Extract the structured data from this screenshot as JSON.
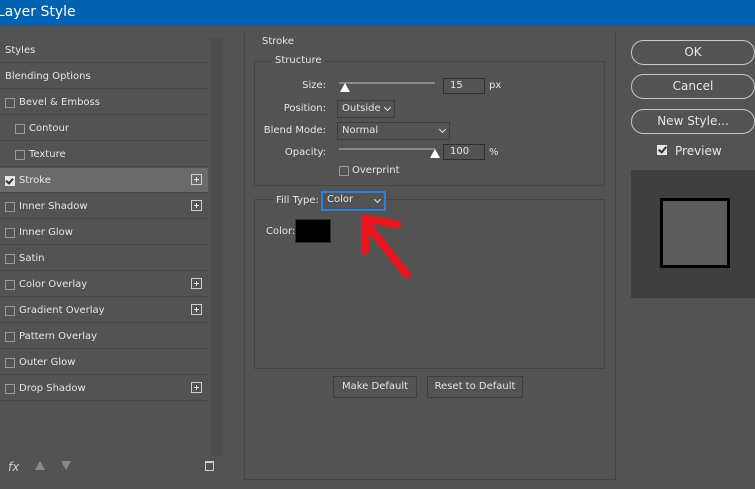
{
  "window": {
    "title": "Layer Style"
  },
  "sidebar": {
    "items": [
      {
        "label": "Styles",
        "checkbox": false,
        "checked": false,
        "indent": false,
        "plus": false,
        "selected": false
      },
      {
        "label": "Blending Options",
        "checkbox": false,
        "checked": false,
        "indent": false,
        "plus": false,
        "selected": false
      },
      {
        "label": "Bevel & Emboss",
        "checkbox": true,
        "checked": false,
        "indent": false,
        "plus": false,
        "selected": false
      },
      {
        "label": "Contour",
        "checkbox": true,
        "checked": false,
        "indent": true,
        "plus": false,
        "selected": false
      },
      {
        "label": "Texture",
        "checkbox": true,
        "checked": false,
        "indent": true,
        "plus": false,
        "selected": false
      },
      {
        "label": "Stroke",
        "checkbox": true,
        "checked": true,
        "indent": false,
        "plus": true,
        "selected": true
      },
      {
        "label": "Inner Shadow",
        "checkbox": true,
        "checked": false,
        "indent": false,
        "plus": true,
        "selected": false
      },
      {
        "label": "Inner Glow",
        "checkbox": true,
        "checked": false,
        "indent": false,
        "plus": false,
        "selected": false
      },
      {
        "label": "Satin",
        "checkbox": true,
        "checked": false,
        "indent": false,
        "plus": false,
        "selected": false
      },
      {
        "label": "Color Overlay",
        "checkbox": true,
        "checked": false,
        "indent": false,
        "plus": true,
        "selected": false
      },
      {
        "label": "Gradient Overlay",
        "checkbox": true,
        "checked": false,
        "indent": false,
        "plus": true,
        "selected": false
      },
      {
        "label": "Pattern Overlay",
        "checkbox": true,
        "checked": false,
        "indent": false,
        "plus": false,
        "selected": false
      },
      {
        "label": "Outer Glow",
        "checkbox": true,
        "checked": false,
        "indent": false,
        "plus": false,
        "selected": false
      },
      {
        "label": "Drop Shadow",
        "checkbox": true,
        "checked": false,
        "indent": false,
        "plus": true,
        "selected": false
      }
    ],
    "fx_label": "fx"
  },
  "stroke": {
    "title": "Stroke",
    "structure_title": "Structure",
    "size": {
      "label": "Size:",
      "value": "15",
      "unit": "px",
      "slider_fraction": 0.06
    },
    "position": {
      "label": "Position:",
      "value": "Outside"
    },
    "blend_mode": {
      "label": "Blend Mode:",
      "value": "Normal"
    },
    "opacity": {
      "label": "Opacity:",
      "value": "100",
      "unit": "%",
      "slider_fraction": 1.0
    },
    "overprint": {
      "label": "Overprint",
      "checked": false
    },
    "fill_type": {
      "label": "Fill Type:",
      "value": "Color"
    },
    "color": {
      "label": "Color:",
      "swatch": "#000000"
    },
    "make_default_label": "Make Default",
    "reset_default_label": "Reset to Default"
  },
  "buttons": {
    "ok": "OK",
    "cancel": "Cancel",
    "new_style": "New Style..."
  },
  "preview": {
    "label": "Preview",
    "checked": true
  },
  "colors": {
    "titlebar": "#0063b1",
    "panel": "#535353",
    "annotation": "#e8141e"
  }
}
